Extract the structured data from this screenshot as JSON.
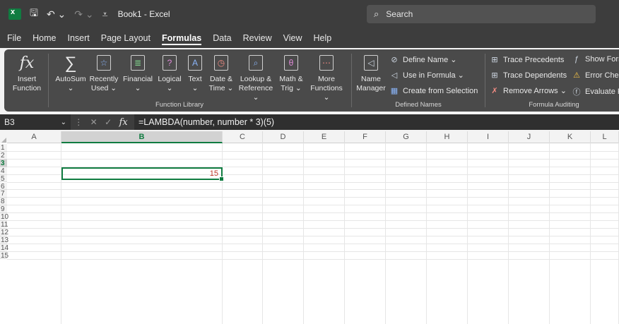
{
  "title_bar": {
    "save_icon": "save-icon",
    "undo_icon": "undo-icon",
    "doc_title": "Book1 - Excel",
    "search_placeholder": "Search"
  },
  "menu": {
    "tabs": [
      "File",
      "Home",
      "Insert",
      "Page Layout",
      "Formulas",
      "Data",
      "Review",
      "View",
      "Help"
    ],
    "active": "Formulas"
  },
  "ribbon": {
    "function_library": {
      "label": "Function Library",
      "buttons": [
        {
          "line1": "Insert",
          "line2": "Function"
        },
        {
          "line1": "AutoSum",
          "line2": "⌄"
        },
        {
          "line1": "Recently",
          "line2": "Used ⌄"
        },
        {
          "line1": "Financial",
          "line2": "⌄"
        },
        {
          "line1": "Logical",
          "line2": "⌄"
        },
        {
          "line1": "Text",
          "line2": "⌄"
        },
        {
          "line1": "Date &",
          "line2": "Time ⌄"
        },
        {
          "line1": "Lookup &",
          "line2": "Reference ⌄"
        },
        {
          "line1": "Math &",
          "line2": "Trig ⌄"
        },
        {
          "line1": "More",
          "line2": "Functions ⌄"
        }
      ]
    },
    "defined_names": {
      "label": "Defined Names",
      "name_manager": {
        "line1": "Name",
        "line2": "Manager"
      },
      "define_name": "Define Name ⌄",
      "use_in_formula": "Use in Formula ⌄",
      "create_from_selection": "Create from Selection"
    },
    "formula_auditing": {
      "label": "Formula Auditing",
      "trace_precedents": "Trace Precedents",
      "trace_dependents": "Trace Dependents",
      "remove_arrows": "Remove Arrows  ⌄",
      "show_formulas": "Show Form",
      "error_checking": "Error Check",
      "evaluate_formula": "Evaluate Fo"
    }
  },
  "formula_bar": {
    "name_box": "B3",
    "fx": "fx",
    "formula": "=LAMBDA(number, number * 3)(5)"
  },
  "grid": {
    "columns": [
      "A",
      "B",
      "C",
      "D",
      "E",
      "F",
      "G",
      "H",
      "I",
      "J",
      "K",
      "L"
    ],
    "rows": [
      "1",
      "2",
      "3",
      "4",
      "5",
      "6",
      "7",
      "8",
      "9",
      "10",
      "11",
      "12",
      "13",
      "14",
      "15"
    ],
    "selected_col": "B",
    "selected_row": "3",
    "b3_value": "15"
  }
}
